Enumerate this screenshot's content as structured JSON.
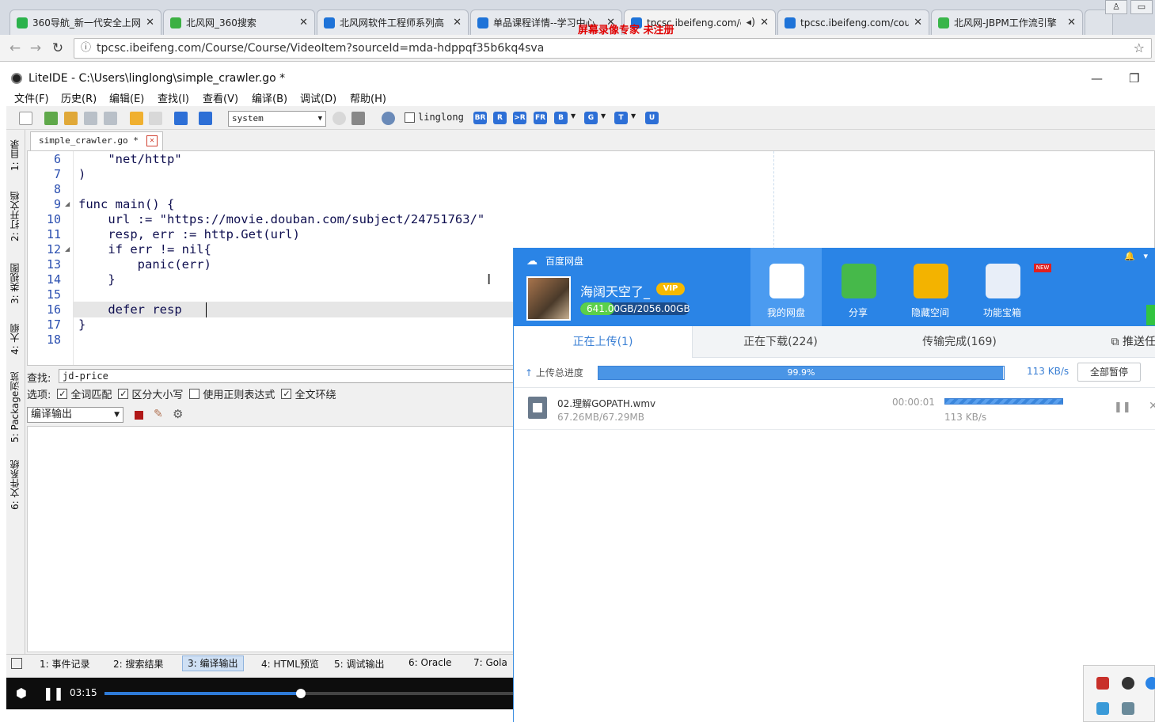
{
  "browser": {
    "tabs": [
      {
        "title": "360导航_新一代安全上网",
        "icon_color": "#2bb24c"
      },
      {
        "title": "北风网_360搜索",
        "icon_color": "#3cb043"
      },
      {
        "title": "北风网软件工程师系列高",
        "icon_color": "#1e73d8"
      },
      {
        "title": "单品课程详情--学习中心",
        "icon_color": "#1e73d8"
      },
      {
        "title": "tpcsc.ibeifeng.com/c",
        "icon_color": "#1e73d8"
      },
      {
        "title": "tpcsc.ibeifeng.com/cou",
        "icon_color": "#1e73d8"
      },
      {
        "title": "北风网-JBPM工作流引擎",
        "icon_color": "#39b54a"
      }
    ],
    "close_glyph": "✕",
    "watermark": "屏幕录像专家 未注册",
    "address": "tpcsc.ibeifeng.com/Course/Course/VideoItem?sourceId=mda-hdppqf35b6kq4sva",
    "nav": {
      "back": "←",
      "forward": "→",
      "reload": "↻",
      "info": "ⓘ",
      "star": "☆"
    }
  },
  "ide": {
    "title": "LiteIDE - C:\\Users\\linglong\\simple_crawler.go *",
    "menu": [
      "文件(F)",
      "历史(R)",
      "编辑(E)",
      "查找(I)",
      "查看(V)",
      "编译(B)",
      "调试(D)",
      "帮助(H)"
    ],
    "toolbar": {
      "env": "system",
      "user_checkbox": "linglong",
      "letter_buttons": [
        "BR",
        "R",
        ">R",
        "FR",
        "B",
        "G",
        "T",
        "U"
      ]
    },
    "sidebar_tabs": [
      "1: 目录",
      "2: 打开文档",
      "3: 类视图",
      "4: 大纲",
      "5: Package浏览",
      "6: 文件系统"
    ],
    "editor_tab": "simple_crawler.go *",
    "code_lines": [
      {
        "num": "6",
        "text": "    \"net/http\""
      },
      {
        "num": "7",
        "text": ")"
      },
      {
        "num": "8",
        "text": ""
      },
      {
        "num": "9",
        "text": "func main() {"
      },
      {
        "num": "10",
        "text": "    url := \"https://movie.douban.com/subject/24751763/\""
      },
      {
        "num": "11",
        "text": "    resp, err := http.Get(url)"
      },
      {
        "num": "12",
        "text": "    if err != nil{"
      },
      {
        "num": "13",
        "text": "        panic(err)"
      },
      {
        "num": "14",
        "text": "    }"
      },
      {
        "num": "15",
        "text": ""
      },
      {
        "num": "16",
        "text": "    defer resp"
      },
      {
        "num": "17",
        "text": "}"
      },
      {
        "num": "18",
        "text": ""
      }
    ],
    "find": {
      "label": "查找:",
      "value": "jd-price",
      "options_label": "选项:",
      "options": [
        {
          "label": "全词匹配",
          "checked": true
        },
        {
          "label": "区分大小写",
          "checked": true
        },
        {
          "label": "使用正则表达式",
          "checked": false
        },
        {
          "label": "全文环绕",
          "checked": true
        }
      ]
    },
    "output_select": "编译输出",
    "bottom_tabs": [
      "1: 事件记录",
      "2: 搜索结果",
      "3: 编译输出",
      "4: HTML预览",
      "5: 调试输出",
      "6: Oracle",
      "7: Gola"
    ],
    "active_bottom_tab": 2,
    "player": {
      "time": "03:15",
      "progress": 0.48
    }
  },
  "baidu": {
    "title": "百度网盘",
    "user": "海阔天空了_",
    "vip": "VIP",
    "quota": "641.00GB/2056.00GB",
    "quota_used": 0.312,
    "nav": [
      {
        "label": "我的网盘",
        "color": "#ffffff"
      },
      {
        "label": "分享",
        "color": "#46b94a"
      },
      {
        "label": "隐藏空间",
        "color": "#f3b300"
      },
      {
        "label": "功能宝箱",
        "color": "#e8eef8"
      }
    ],
    "new_badge": "NEW",
    "tabs": [
      "正在上传(1)",
      "正在下载(224)",
      "传输完成(169)"
    ],
    "push_tab": "推送任",
    "progress_label": "上传总进度",
    "progress_text": "99.9%",
    "progress_value": 0.999,
    "speed": "113 KB/s",
    "pause_all": "全部暂停",
    "file": {
      "name": "02.理解GOPATH.wmv",
      "size": "67.26MB/67.29MB",
      "remaining": "00:00:01",
      "speed": "113 KB/s",
      "progress": 0.999
    }
  }
}
